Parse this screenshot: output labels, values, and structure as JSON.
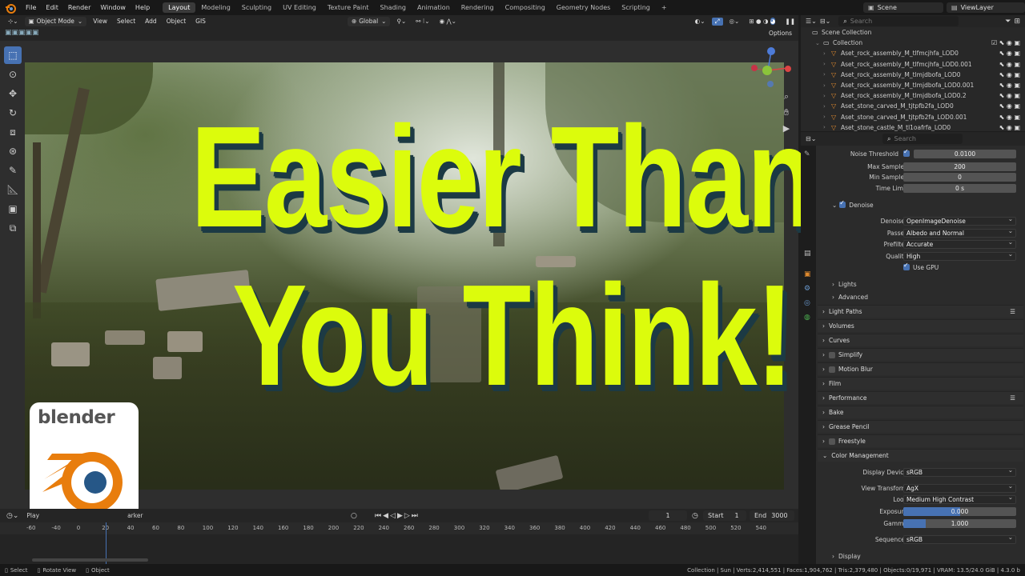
{
  "menu": {
    "items": [
      "File",
      "Edit",
      "Render",
      "Window",
      "Help"
    ]
  },
  "workspaces": {
    "tabs": [
      "Layout",
      "Modeling",
      "Sculpting",
      "UV Editing",
      "Texture Paint",
      "Shading",
      "Animation",
      "Rendering",
      "Compositing",
      "Geometry Nodes",
      "Scripting"
    ],
    "active": "Layout",
    "add": "+"
  },
  "scene": {
    "name": "Scene",
    "view_layer": "ViewLayer",
    "search_placeholder": "Search"
  },
  "viewport": {
    "mode": "Object Mode",
    "menus": [
      "View",
      "Select",
      "Add",
      "Object",
      "GIS"
    ],
    "transform": "Global",
    "options": "Options"
  },
  "overlay": {
    "line1": "Easier Than",
    "line2": "You Think!",
    "color": "#dcfc0c"
  },
  "logo": {
    "word": "blender",
    "brand_orange": "#e87d0d",
    "brand_blue": "#265787"
  },
  "outliner": {
    "root": "Scene Collection",
    "collection": "Collection",
    "items": [
      "Aset_rock_assembly_M_tlfmcjhfa_LOD0",
      "Aset_rock_assembly_M_tlfmcjhfa_LOD0.001",
      "Aset_rock_assembly_M_tlmjdbofa_LOD0",
      "Aset_rock_assembly_M_tlmjdbofa_LOD0.001",
      "Aset_rock_assembly_M_tlmjdbofa_LOD0.2",
      "Aset_stone_carved_M_tjtpfb2fa_LOD0",
      "Aset_stone_carved_M_tjtpfb2fa_LOD0.001",
      "Aset_stone_castle_M_tl1oafrfa_LOD0"
    ]
  },
  "properties": {
    "search_placeholder": "Search",
    "noise_threshold": {
      "label": "Noise Threshold",
      "value": "0.0100"
    },
    "max_samples": {
      "label": "Max Samples",
      "value": "200"
    },
    "min_samples": {
      "label": "Min Samples",
      "value": "0"
    },
    "time_limit": {
      "label": "Time Limit",
      "value": "0 s"
    },
    "denoise": {
      "label": "Denoise"
    },
    "denoiser": {
      "label": "Denoiser",
      "value": "OpenImageDenoise"
    },
    "passes": {
      "label": "Passes",
      "value": "Albedo and Normal"
    },
    "prefilter": {
      "label": "Prefilter",
      "value": "Accurate"
    },
    "quality": {
      "label": "Quality",
      "value": "High"
    },
    "use_gpu": "Use GPU",
    "subpanels": [
      "Lights",
      "Advanced"
    ],
    "panels": [
      "Light Paths",
      "Volumes",
      "Curves",
      "Simplify",
      "Motion Blur",
      "Film",
      "Performance",
      "Bake",
      "Grease Pencil",
      "Freestyle",
      "Color Management"
    ],
    "display_device": {
      "label": "Display Device",
      "value": "sRGB"
    },
    "view_transform": {
      "label": "View Transform",
      "value": "AgX"
    },
    "look": {
      "label": "Look",
      "value": "Medium High Contrast"
    },
    "exposure": {
      "label": "Exposure",
      "value": "0.000",
      "fill": 0.5
    },
    "gamma": {
      "label": "Gamma",
      "value": "1.000",
      "fill": 0.2
    },
    "sequencer": {
      "label": "Sequencer",
      "value": "sRGB"
    },
    "display": "Display"
  },
  "timeline": {
    "playback": "Play",
    "marker": "arker",
    "current_frame": "1",
    "start_label": "Start",
    "start": "1",
    "end_label": "End",
    "end": "3000",
    "ticks": [
      "-60",
      "-40",
      "0",
      "20",
      "40",
      "60",
      "80",
      "100",
      "120",
      "140",
      "160",
      "180",
      "200",
      "220",
      "240",
      "260",
      "280",
      "300",
      "320",
      "340",
      "360",
      "380",
      "400",
      "420",
      "440",
      "460",
      "480",
      "500",
      "520",
      "540"
    ]
  },
  "status": {
    "left": [
      "Select",
      "Rotate View",
      "Object"
    ],
    "right": "Collection | Sun | Verts:2,414,551 | Faces:1,904,762 | Tris:2,379,480 | Objects:0/19,971 | VRAM: 13.5/24.0 GiB | 4.3.0 b"
  }
}
